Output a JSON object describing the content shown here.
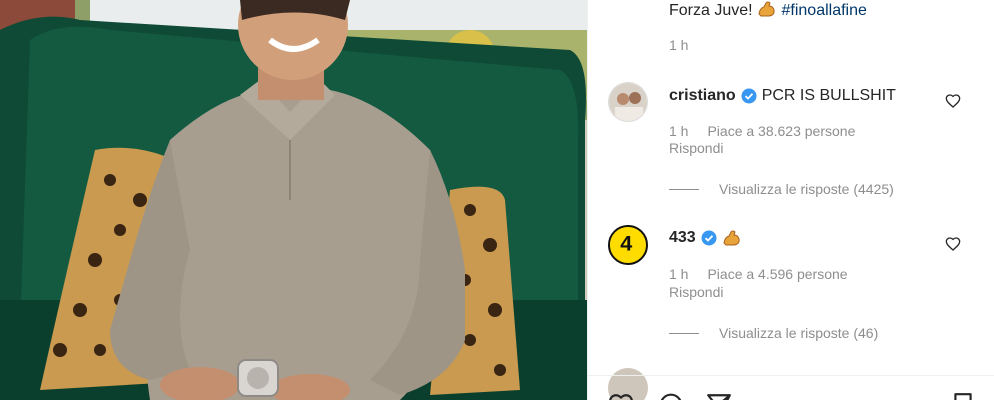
{
  "post": {
    "caption_text": "Forza Juve!",
    "caption_emoji": "flexed-biceps-emoji",
    "caption_hashtag": "#finoallafine",
    "caption_time": "1 h"
  },
  "comments": [
    {
      "username": "cristiano",
      "verified": true,
      "text": "PCR IS BULLSHIT",
      "time": "1 h",
      "likes": "Piace a 38.623 persone",
      "reply": "Rispondi",
      "view_replies": "Visualizza le risposte (4425)"
    },
    {
      "username": "433",
      "verified": true,
      "text_emoji": "flexed-biceps-emoji",
      "avatar_label": "4",
      "time": "1 h",
      "likes": "Piace a 4.596 persone",
      "reply": "Rispondi",
      "view_replies": "Visualizza le risposte (46)"
    }
  ],
  "icons": {
    "like": "heart-icon",
    "verified": "verified-badge-icon",
    "comment": "comment-icon",
    "share": "share-icon",
    "save": "bookmark-icon"
  },
  "colors": {
    "hashtag": "#00376b",
    "verified_blue": "#3897f0",
    "secondary_text": "#8e8e8e"
  }
}
